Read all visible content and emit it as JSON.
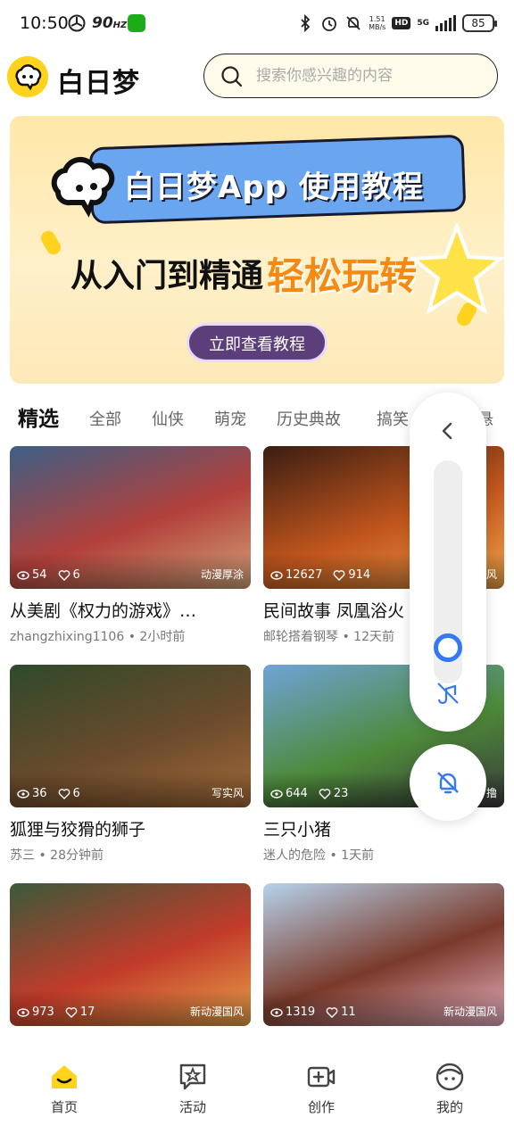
{
  "status_bar": {
    "time": "10:50",
    "refresh_rate": "90",
    "refresh_unit": "HZ",
    "net_speed": "1.51",
    "net_unit": "MB/s",
    "hd": "HD",
    "network": "5G",
    "battery": "85"
  },
  "header": {
    "app_name": "白日梦",
    "search_placeholder": "搜索你感兴趣的内容"
  },
  "banner": {
    "title": "白日梦App 使用教程",
    "subtitle_a": "从入门到精通",
    "subtitle_b": "轻松玩转",
    "button": "立即查看教程"
  },
  "tabs": [
    "精选",
    "全部",
    "仙侠",
    "萌宠",
    "历史典故",
    "搞笑",
    "悬"
  ],
  "cards": [
    {
      "views": "54",
      "likes": "6",
      "style": "动漫厚涂",
      "title": "从美剧《权力的游戏》…",
      "author": "zhangzhixing1106",
      "time": "2小时前",
      "colors": [
        "#3d5f86",
        "#b2403a",
        "#d3a37a"
      ]
    },
    {
      "views": "12627",
      "likes": "914",
      "style": "风",
      "title": "民间故事 凤凰浴火",
      "author": "邮轮搭着钢琴",
      "time": "12天前",
      "colors": [
        "#3a1d12",
        "#c2561d",
        "#f0a24a"
      ]
    },
    {
      "views": "36",
      "likes": "6",
      "style": "写实风",
      "title": "狐狸与狡猾的狮子",
      "author": "苏三",
      "time": "28分钟前",
      "colors": [
        "#2f4a2a",
        "#6a4a2c",
        "#a36a38"
      ]
    },
    {
      "views": "644",
      "likes": "23",
      "style": "撸",
      "title": "三只小猪",
      "author": "迷人的危险",
      "time": "1天前",
      "colors": [
        "#6fa3d8",
        "#4d8a3a",
        "#3a3a3a"
      ]
    },
    {
      "views": "973",
      "likes": "17",
      "style": "新动漫国风",
      "title": "",
      "author": "",
      "time": "",
      "colors": [
        "#3a5a3a",
        "#c23b2a",
        "#e8a24a"
      ]
    },
    {
      "views": "1319",
      "likes": "11",
      "style": "新动漫国风",
      "title": "",
      "author": "",
      "time": "",
      "colors": [
        "#b6d3ec",
        "#7a3a2a",
        "#e8b0c0"
      ]
    }
  ],
  "bottom_nav": [
    {
      "label": "首页",
      "icon": "home-icon",
      "active": true
    },
    {
      "label": "活动",
      "icon": "activity-icon",
      "active": false
    },
    {
      "label": "创作",
      "icon": "create-icon",
      "active": false
    },
    {
      "label": "我的",
      "icon": "profile-icon",
      "active": false
    }
  ],
  "colors": {
    "brand_yellow": "#ffd21e",
    "accent_blue": "#3478f6"
  }
}
